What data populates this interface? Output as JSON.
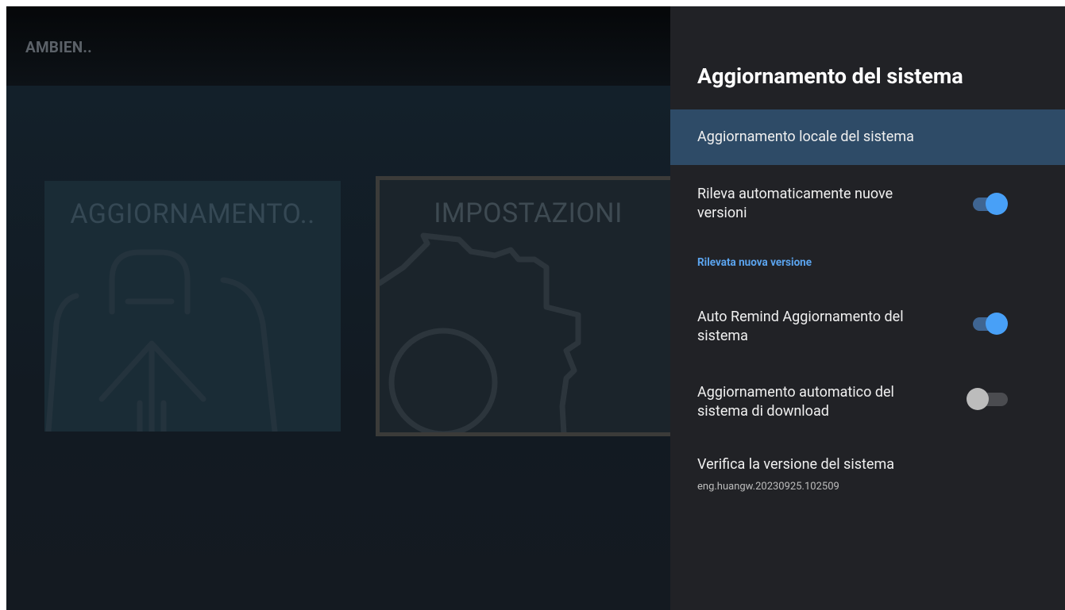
{
  "app": {
    "title": "AMBIEN.."
  },
  "tiles": [
    {
      "label": "AGGIORNAMENTO..",
      "icon": "upload-bag-icon"
    },
    {
      "label": "IMPOSTAZIONI",
      "icon": "gear-icon"
    }
  ],
  "panel": {
    "title": "Aggiornamento del sistema",
    "items": [
      {
        "label": "Aggiornamento locale del sistema"
      },
      {
        "label": "Rileva automaticamente nuove versioni",
        "toggle": "on"
      },
      {
        "section": "Rilevata nuova versione"
      },
      {
        "label": "Auto Remind Aggiornamento del sistema",
        "toggle": "on"
      },
      {
        "label": "Aggiornamento automatico del sistema di download",
        "toggle": "off"
      },
      {
        "label": "Verifica la versione del sistema",
        "sub": "eng.huangw.20230925.102509"
      }
    ]
  },
  "colors": {
    "accent": "#48a0f7",
    "focus_bg": "#2e4b67",
    "panel_bg": "#212226"
  }
}
